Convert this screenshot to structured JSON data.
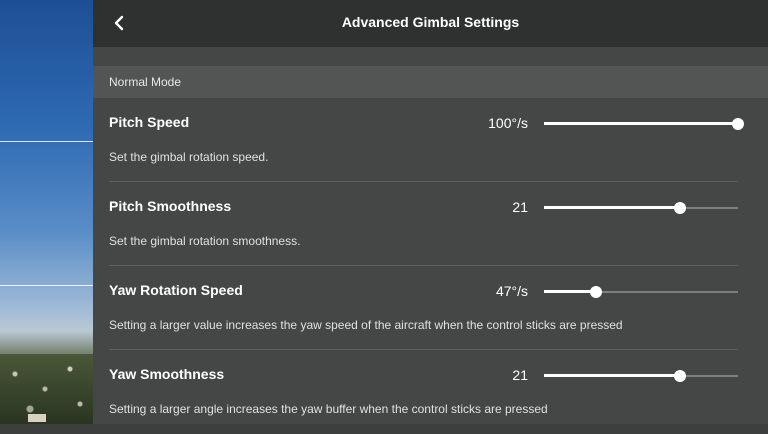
{
  "header": {
    "title": "Advanced Gimbal Settings",
    "back_icon": "chevron-left-icon"
  },
  "section": {
    "label": "Normal Mode"
  },
  "settings": [
    {
      "name": "Pitch Speed",
      "value": "100°/s",
      "description": "Set the gimbal rotation speed.",
      "level": 1.0
    },
    {
      "name": "Pitch Smoothness",
      "value": "21",
      "description": "Set the gimbal rotation smoothness.",
      "level": 0.7
    },
    {
      "name": "Yaw Rotation Speed",
      "value": "47°/s",
      "description": "Setting a larger value increases the yaw speed of the aircraft when the control sticks are pressed",
      "level": 0.27
    },
    {
      "name": "Yaw Smoothness",
      "value": "21",
      "description": "Setting a larger angle increases the yaw buffer when the control sticks are pressed",
      "level": 0.7
    }
  ],
  "colors": {
    "titlebar_bg": "#2e3130",
    "panel_bg": "#454746",
    "section_bg": "#525553",
    "accent": "#ffffff"
  }
}
